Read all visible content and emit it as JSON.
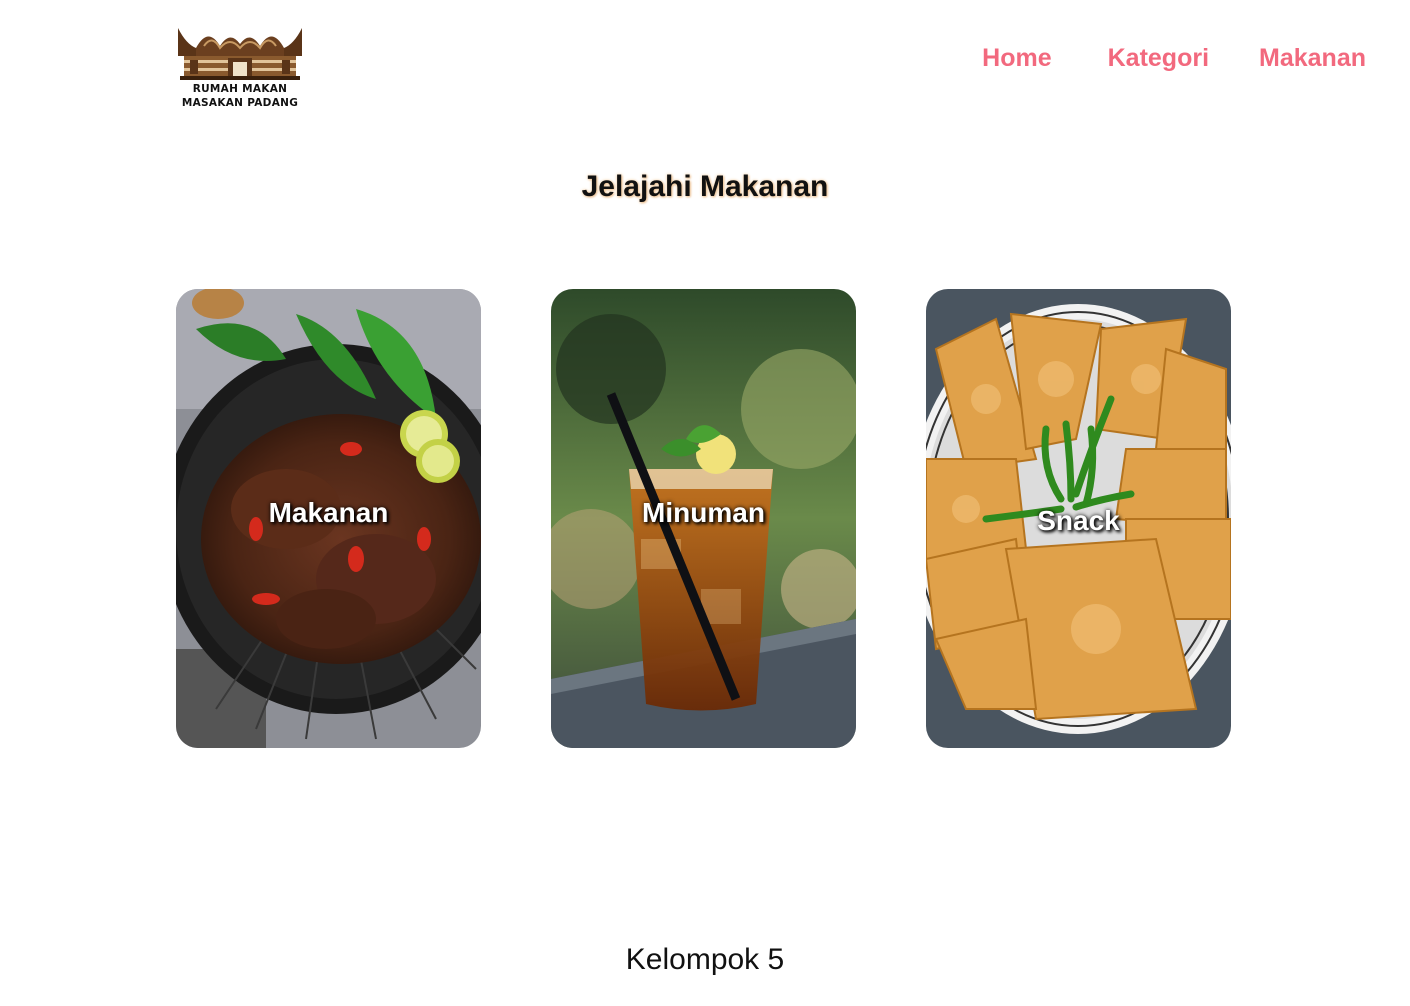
{
  "logo": {
    "line1": "RUMAH MAKAN",
    "line2": "MASAKAN PADANG",
    "icon": "rumah-gadang-icon"
  },
  "nav": {
    "items": [
      {
        "label": "Home"
      },
      {
        "label": "Kategori"
      },
      {
        "label": "Makanan"
      }
    ],
    "color": "#f2697e"
  },
  "title": "Jelajahi Makanan",
  "categories": [
    {
      "label": "Makanan",
      "image": "rendang-photo"
    },
    {
      "label": "Minuman",
      "image": "iced-tea-photo"
    },
    {
      "label": "Snack",
      "image": "fried-tempeh-photo"
    }
  ],
  "footer": {
    "text": "Kelompok 5"
  }
}
